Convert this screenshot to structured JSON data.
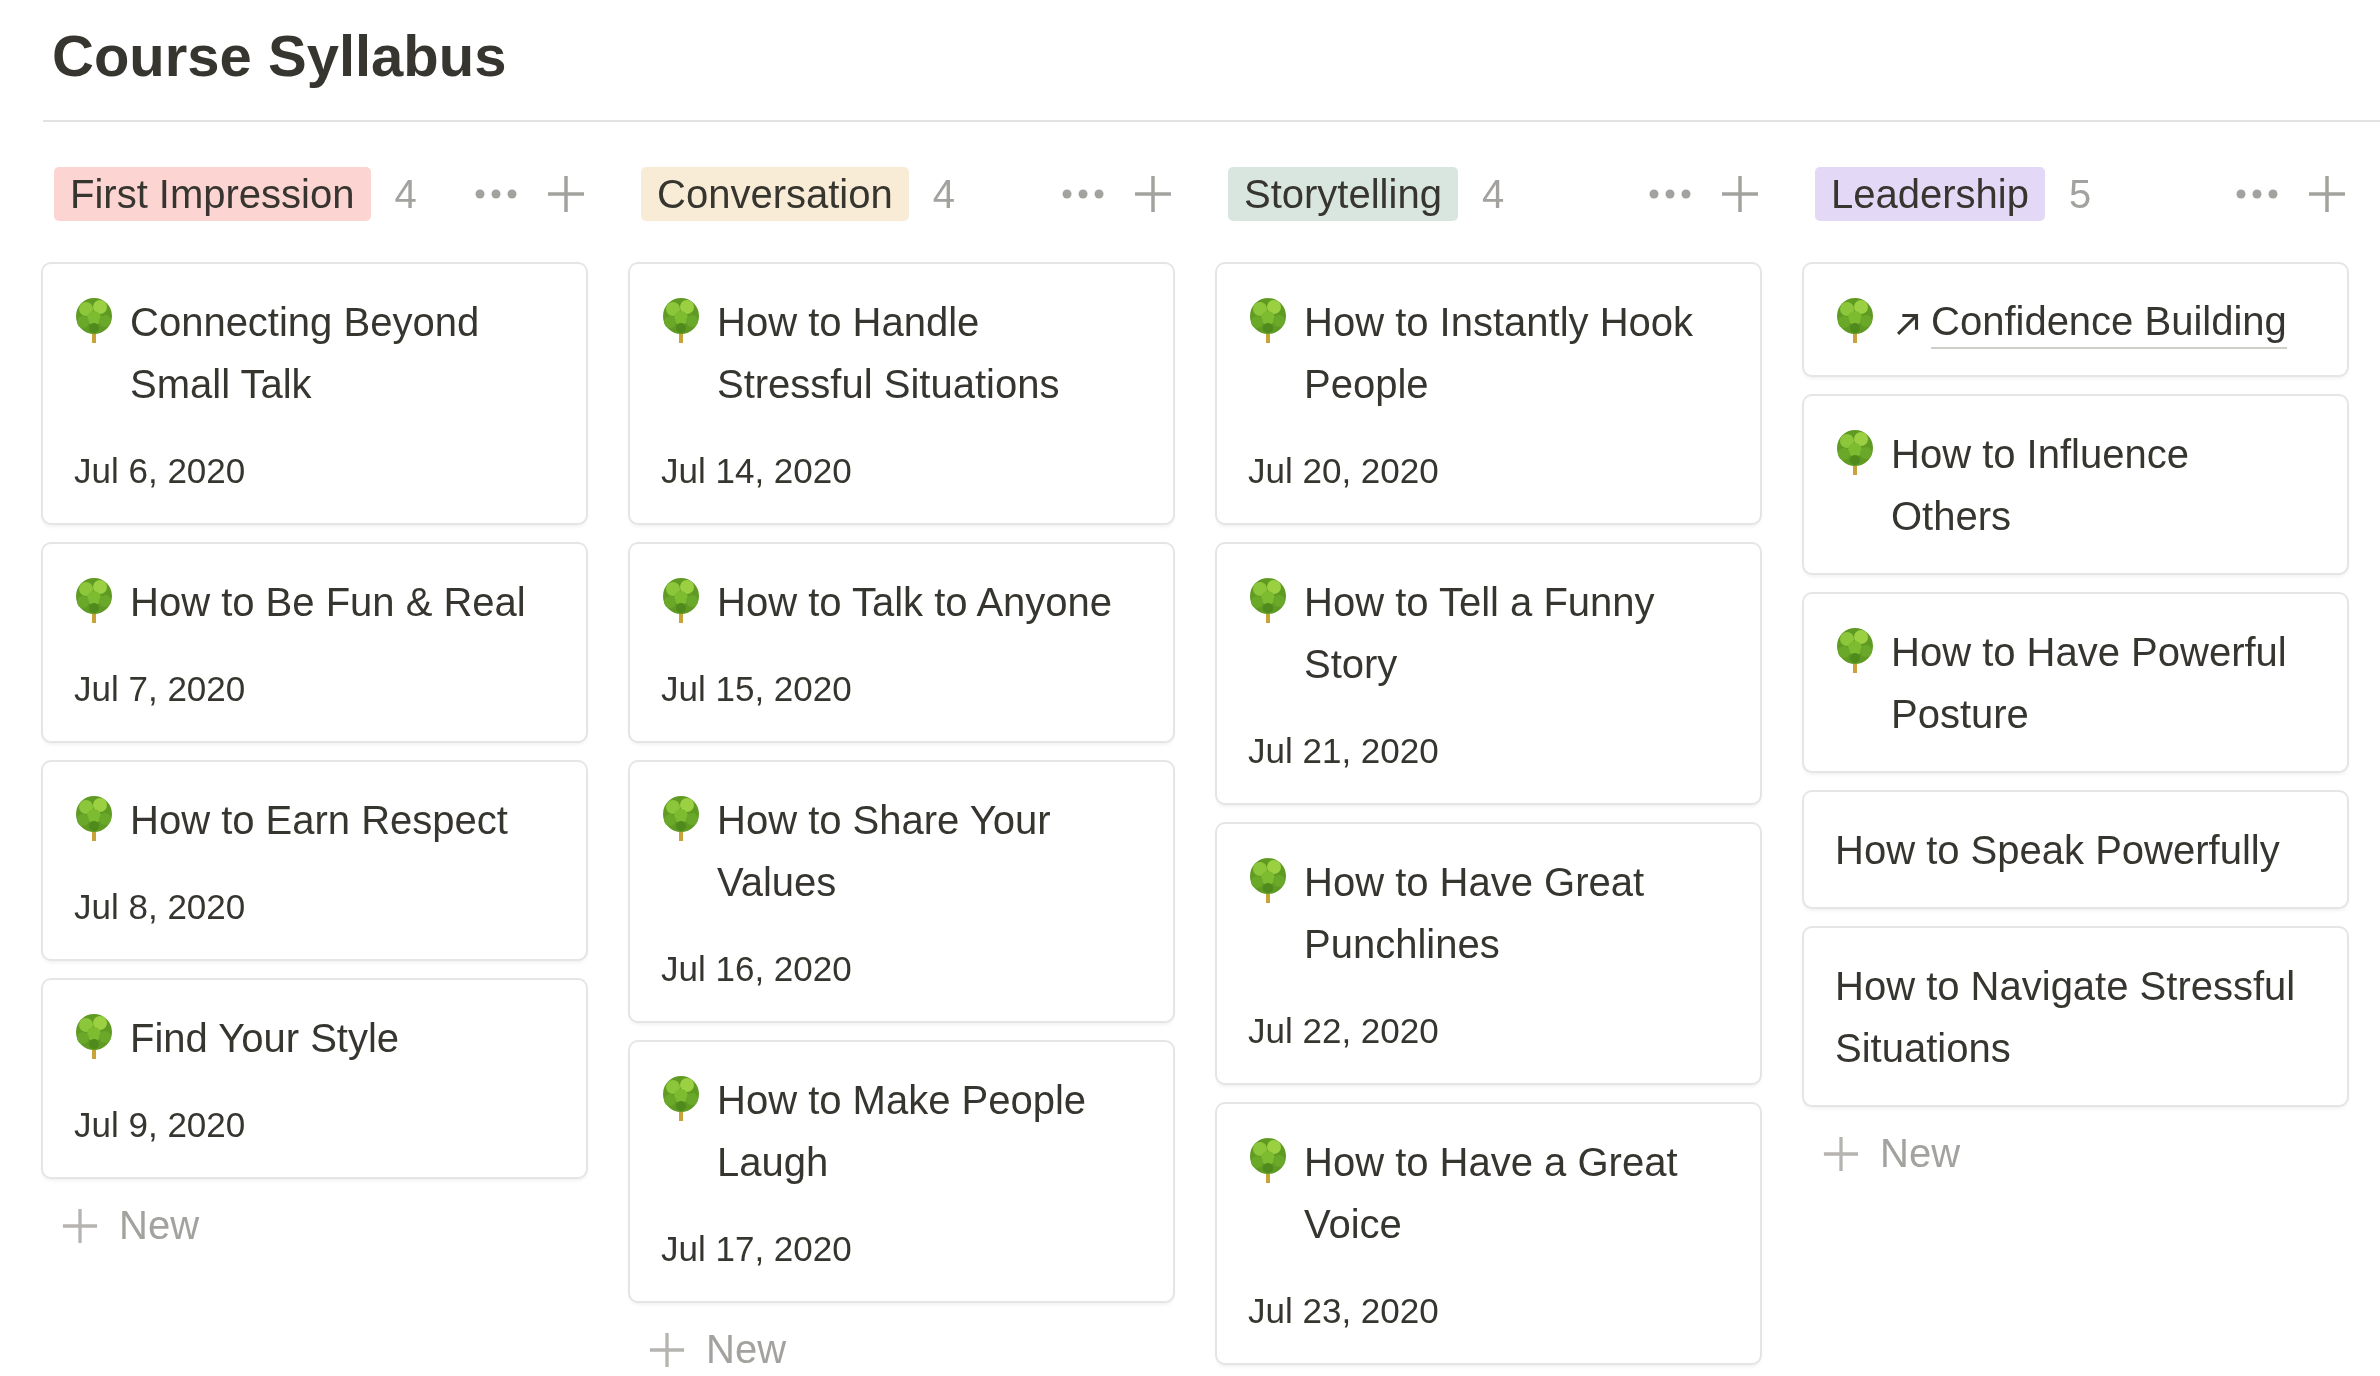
{
  "title": "Course Syllabus",
  "columns": [
    {
      "name": "First Impression",
      "color": "#fcd4d2",
      "count": "4",
      "new_label": "New",
      "cards": [
        {
          "kind": "page",
          "title": "Connecting Beyond Small Talk",
          "date": "Jul 6, 2020"
        },
        {
          "kind": "page",
          "title": "How to Be Fun & Real",
          "date": "Jul 7, 2020"
        },
        {
          "kind": "page",
          "title": "How to Earn Respect",
          "date": "Jul 8, 2020"
        },
        {
          "kind": "page",
          "title": "Find Your Style",
          "date": "Jul 9, 2020"
        }
      ]
    },
    {
      "name": "Conversation",
      "color": "#f8ecd6",
      "count": "4",
      "new_label": "New",
      "cards": [
        {
          "kind": "page",
          "title": "How to Handle Stressful Situations",
          "date": "Jul 14, 2020"
        },
        {
          "kind": "page",
          "title": "How to Talk to Anyone",
          "date": "Jul 15, 2020"
        },
        {
          "kind": "page",
          "title": "How to Share Your Values",
          "date": "Jul 16, 2020"
        },
        {
          "kind": "page",
          "title": "How to Make People Laugh",
          "date": "Jul 17, 2020"
        }
      ]
    },
    {
      "name": "Storytelling",
      "color": "#d9e6df",
      "count": "4",
      "cards": [
        {
          "kind": "page",
          "title": "How to Instantly Hook People",
          "date": "Jul 20, 2020"
        },
        {
          "kind": "page",
          "title": "How to Tell a Funny Story",
          "date": "Jul 21, 2020"
        },
        {
          "kind": "page",
          "title": "How to Have Great Punchlines",
          "date": "Jul 22, 2020"
        },
        {
          "kind": "page",
          "title": "How to Have a Great Voice",
          "date": "Jul 23, 2020"
        }
      ]
    },
    {
      "name": "Leadership",
      "color": "#e3d8f6",
      "count": "5",
      "new_label": "New",
      "cards": [
        {
          "kind": "link",
          "title": "Confidence Building"
        },
        {
          "kind": "page",
          "title": "How to Influence Others"
        },
        {
          "kind": "page",
          "title": "How to Have Powerful Posture"
        },
        {
          "kind": "plain",
          "title": "How to Speak Powerfully"
        },
        {
          "kind": "plain",
          "title": "How to Navigate Stressful Situations"
        }
      ]
    }
  ]
}
